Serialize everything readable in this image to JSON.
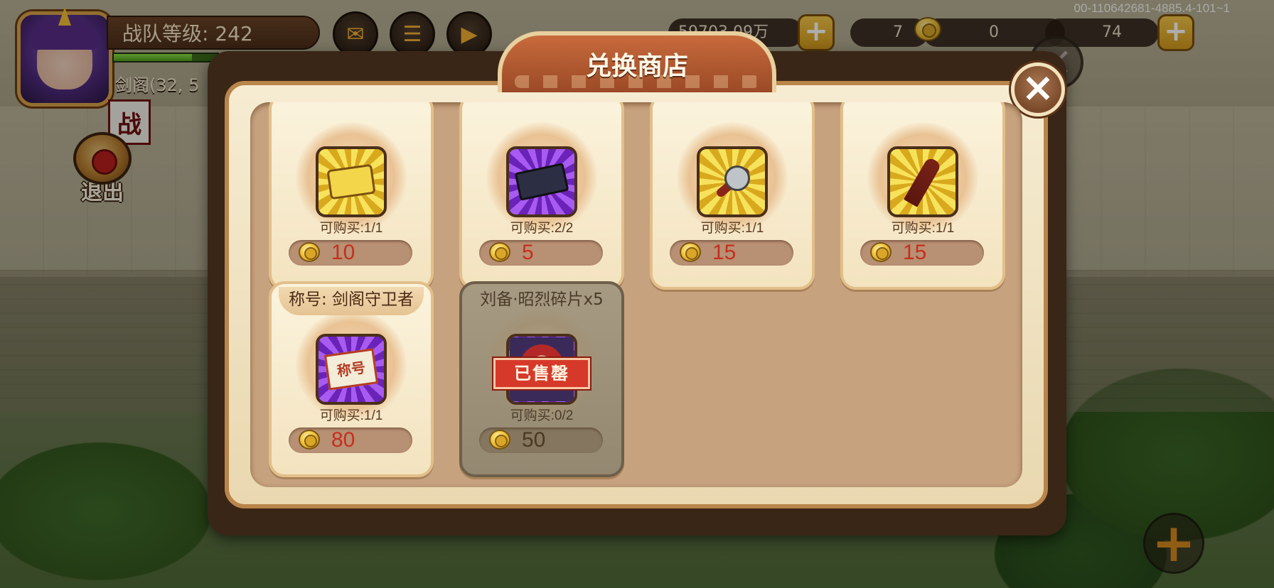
{
  "hud": {
    "team_level": "战队等级: 242",
    "location": "剑阁(32, 5",
    "battle_flag": "战",
    "exit_label": "退出",
    "currency_silver": "59703.09万",
    "currency_gold": "7",
    "currency_token": "0",
    "currency_stamina": "74",
    "add_symbol": "+",
    "close_symbol": "×",
    "debug": "00-110642681-4885.4-101~1",
    "exp_fraction": 0.75
  },
  "shop": {
    "title": "兑换商店",
    "close_symbol": "×",
    "items": [
      {
        "name": "",
        "limit": "可购买:1/1",
        "price": "10",
        "icon": "gold-badge-icon",
        "sold": false
      },
      {
        "name": "",
        "limit": "可购买:2/2",
        "price": "5",
        "icon": "purple-scroll-icon",
        "sold": false
      },
      {
        "name": "",
        "limit": "可购买:1/1",
        "price": "15",
        "icon": "pliers-icon",
        "sold": false
      },
      {
        "name": "",
        "limit": "可购买:1/1",
        "price": "15",
        "icon": "chisel-icon",
        "sold": false
      },
      {
        "name": "称号: 剑阁守卫者",
        "limit": "可购买:1/1",
        "price": "80",
        "icon": "title-scroll-icon",
        "sold": false
      },
      {
        "name": "刘备·昭烈碎片x5",
        "limit": "可购买:0/2",
        "price": "50",
        "icon": "hero-shard-icon",
        "sold": true,
        "sold_label": "已售罄"
      }
    ]
  },
  "colors": {
    "price_red": "#c4301e",
    "frame_gold": "#b9854a",
    "title_orange": "#b45a30"
  }
}
